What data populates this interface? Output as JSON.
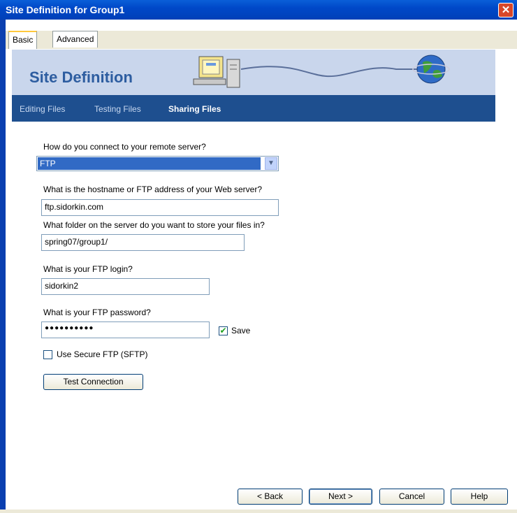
{
  "window": {
    "title": "Site Definition for Group1",
    "close_symbol": "✕"
  },
  "tabs": [
    {
      "label": "Basic",
      "active": true
    },
    {
      "label": "Advanced",
      "active": false
    }
  ],
  "banner": {
    "title": "Site Definition"
  },
  "nav": [
    {
      "label": "Editing Files"
    },
    {
      "label": "Testing Files"
    },
    {
      "label": "Sharing Files",
      "active": true
    }
  ],
  "form": {
    "connect_question": "How do you connect to your remote server?",
    "connect_value": "FTP",
    "host_question": "What is the hostname or FTP address of your Web server?",
    "host_value": "ftp.sidorkin.com",
    "folder_question": "What folder on the server do you want to store your files in?",
    "folder_value": "spring07/group1/",
    "login_question": "What is your FTP login?",
    "login_value": "sidorkin2",
    "password_question": "What is your FTP password?",
    "password_value": "●●●●●●●●●●",
    "save_label": "Save",
    "save_checked": true,
    "sftp_label": "Use Secure FTP (SFTP)",
    "sftp_checked": false,
    "test_button": "Test Connection"
  },
  "footer": {
    "back": "< Back",
    "next": "Next >",
    "cancel": "Cancel",
    "help": "Help"
  }
}
